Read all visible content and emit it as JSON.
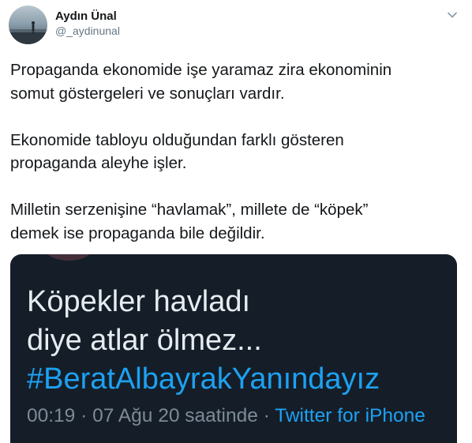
{
  "author": {
    "display_name": "Aydın Ünal",
    "handle": "@_aydinunal",
    "avatar_icon": "profile-photo-silhouette"
  },
  "menu_icon": "chevron-down-icon",
  "tweet": {
    "paragraphs": [
      [
        "Propaganda ekonomide işe yaramaz zira ekonominin",
        "somut göstergeleri ve sonuçları vardır."
      ],
      [
        "Ekonomide tabloyu olduğundan farklı gösteren",
        "propaganda aleyhe işler."
      ],
      [
        "Milletin serzenişine “havlamak”, millete de “köpek”",
        "demek ise propaganda bile değildir."
      ]
    ]
  },
  "media": {
    "line1": "Köpekler havladı",
    "line2": "diye atlar ölmez...",
    "hashtag": "#BeratAlbayrakYanındayız",
    "timestamp": "00:19 · 07 Ağu 20 saatinde",
    "separator": " · ",
    "source": "Twitter for iPhone",
    "colors": {
      "background": "#151e28",
      "text": "#e6ecf0",
      "link": "#1da1f2",
      "muted": "#7c8a97"
    }
  }
}
